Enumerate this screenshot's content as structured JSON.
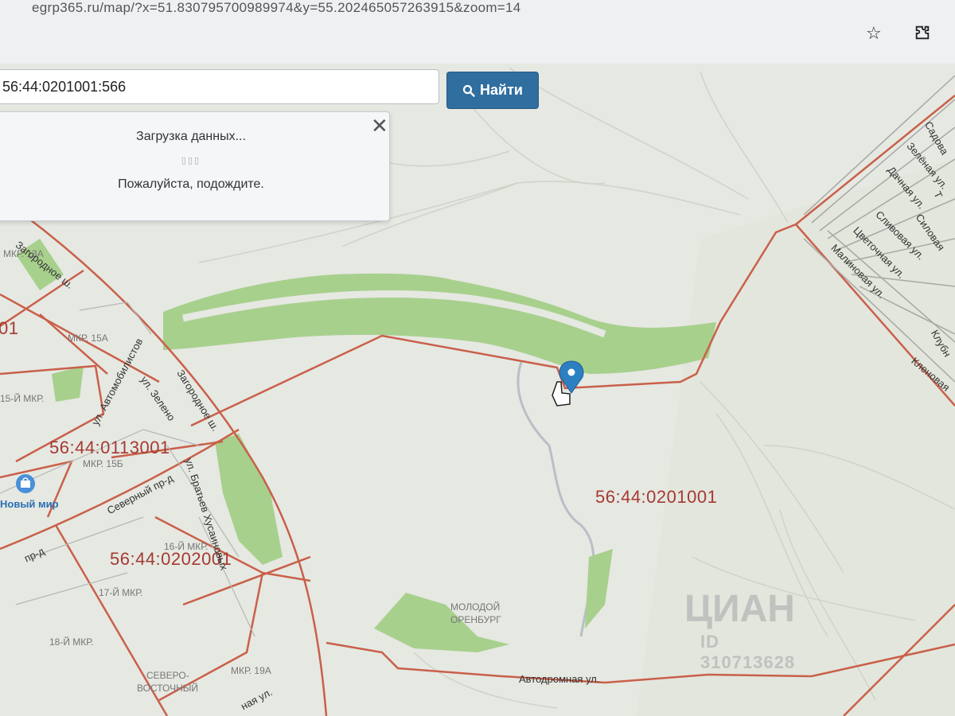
{
  "browser": {
    "url": "egrp365.ru/map/?x=51.830795700989974&y=55.202465057263915&zoom=14",
    "star_icon": "star-icon",
    "extension_icon": "puzzle-icon"
  },
  "search": {
    "value": "56:44:0201001:566",
    "button_label": "Найти",
    "button_icon": "search-icon"
  },
  "loading_dialog": {
    "title": "Загрузка данных...",
    "dots": "▯▯▯",
    "message": "Пожалуйста, подождите.",
    "close_icon": "close-icon"
  },
  "map": {
    "cadastral_labels": [
      "56:44:0201001",
      "56:44:0113001",
      "56:44:0202001"
    ],
    "district_labels": [
      "МКР. 15А",
      "15-Й МКР.",
      "МКР. 15Б",
      "16-Й МКР.",
      "17-Й МКР.",
      "18-Й МКР.",
      "МКР. 19А",
      "МКР. 13А",
      "СЕВЕРО-",
      "ВОСТОЧНЫЙ"
    ],
    "area_labels": [
      "МОЛОДОЙ",
      "ОРЕНБУРГ"
    ],
    "streets": {
      "zagorodnoe_1": "Загородное ш.",
      "zagorodnoe_2": "Загородное ш.",
      "avtomobilistov": "ул. Автомобилистов",
      "zelenaya_left": "ул. Зелено",
      "bratyev": "ул. Братьев Хусаиновых",
      "severny": "Северный пр-д",
      "avtodromnaya": "Автодромная ул.",
      "small_pr": "пр-д",
      "bottom_ul": "ная ул.",
      "sadovaya": "Садова",
      "zelenaya": "Зелёная ул.",
      "dachnaya": "Дачная ул.",
      "slivovaya": "Сливовая ул.",
      "silovaya": "Силовая",
      "tsvetochnaya": "Цветочная ул.",
      "malinovaya": "Малиновая ул.",
      "klubnichnaya": "Клубн",
      "klenovaya": "Кленовая",
      "t_label": "Т"
    },
    "poi": {
      "name": "Новый мир",
      "icon": "shopping-bag-icon"
    },
    "left_fragment": "01",
    "marker_icon": "map-pin-icon",
    "cursor_icon": "hand-cursor-icon"
  },
  "watermark": {
    "logo": "ЦИАН",
    "id": "ID 310713628"
  },
  "colors": {
    "parcel_border": "#c9604a",
    "green_area": "#a8d08d",
    "button": "#2f6e9f",
    "cadastral_text": "#a43a33",
    "marker": "#2c7fc1"
  }
}
